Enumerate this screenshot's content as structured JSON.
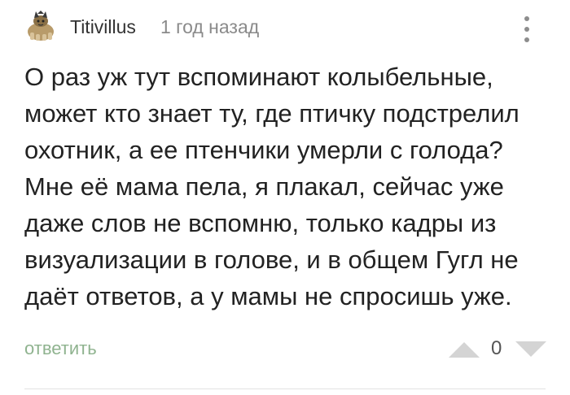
{
  "comment": {
    "author": "Titivillus",
    "time": "1 год назад",
    "avatar_icon": "cat-avatar-icon",
    "more_icon": "more-vertical-icon",
    "text_lines": [
      "О раз уж тут вспоминают колыбельные,",
      "может кто знает ту, где птичку подстрелил",
      "охотник, а ее птенчики умерли с голода?",
      "Мне её мама пела, я плакал, сейчас уже",
      "даже слов не вспомню, только кадры из",
      "визуализации в голове, и в общем Гугл не",
      "даёт ответов, а у мамы не спросишь уже."
    ],
    "reply_label": "ответить",
    "rating": "0",
    "vote_up_icon": "triangle-up-icon",
    "vote_down_icon": "triangle-down-icon"
  },
  "colors": {
    "text": "#222222",
    "muted": "#8a8a8a",
    "reply": "#8fb38f",
    "vote": "#d4d4d4",
    "divider": "#e3e3e3"
  }
}
